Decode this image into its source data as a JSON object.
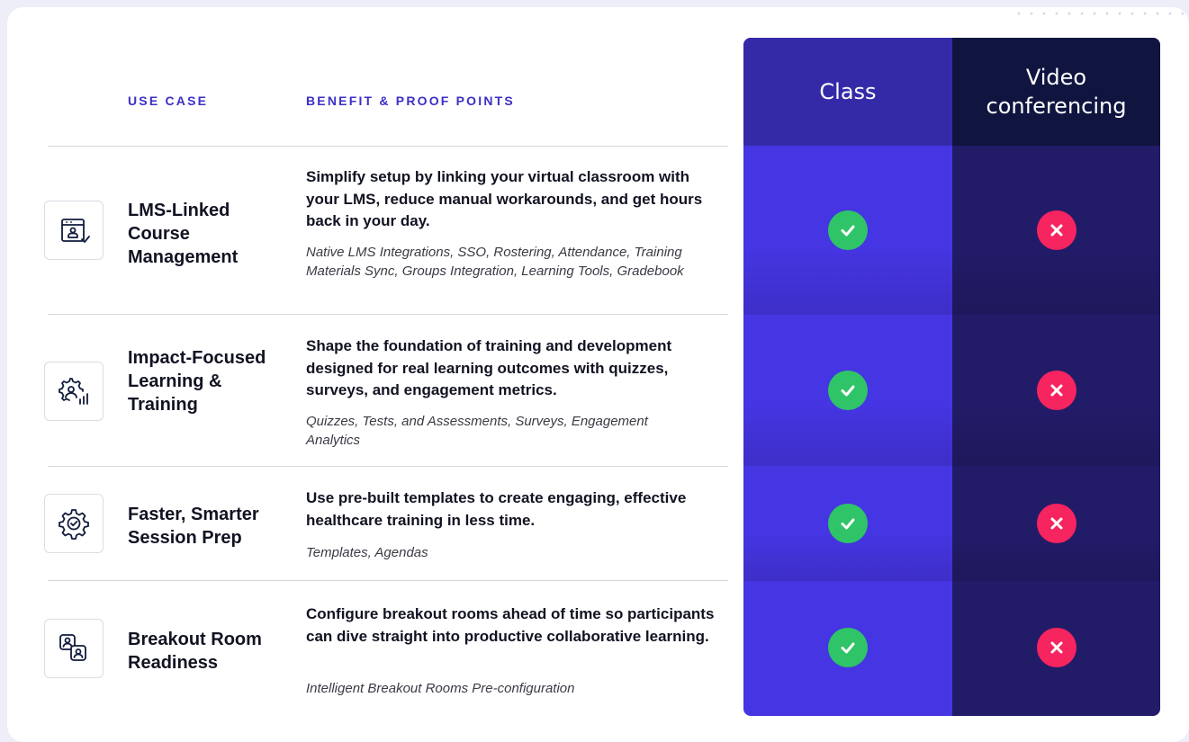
{
  "header": {
    "use_case": "USE CASE",
    "benefit": "BENEFIT & PROOF POINTS",
    "col_class": "Class",
    "col_video": "Video conferencing"
  },
  "rows": [
    {
      "icon": "calendar-user-check-icon",
      "title": "LMS-Linked Course Management",
      "benefit": "Simplify setup by linking your virtual classroom with your LMS, reduce manual workarounds, and get hours back in your day.",
      "proof": "Native LMS Integrations, SSO, Rostering, Attendance, Training Materials Sync, Groups Integration, Learning Tools, Gradebook",
      "class": "check",
      "video": "cross"
    },
    {
      "icon": "gear-user-chart-icon",
      "title": "Impact-Focused Learning & Training",
      "benefit": "Shape the foundation of training and development designed for real learning outcomes with quizzes, surveys, and engagement metrics.",
      "proof": "Quizzes, Tests, and Assessments, Surveys, Engagement Analytics",
      "class": "check",
      "video": "cross"
    },
    {
      "icon": "gear-check-icon",
      "title": "Faster, Smarter Session Prep",
      "benefit": "Use pre-built templates to create engaging, effective healthcare training in less time.",
      "proof": "Templates, Agendas",
      "class": "check",
      "video": "cross"
    },
    {
      "icon": "breakout-users-icon",
      "title": "Breakout Room Readiness",
      "benefit": "Configure breakout rooms ahead of time so participants can dive straight into productive collaborative learning.",
      "proof": "Intelligent Breakout Rooms Pre-configuration",
      "class": "check",
      "video": "cross"
    }
  ],
  "colors": {
    "accent": "#3b2fc6",
    "class_header": "#342aa8",
    "class_column": "#4535e2",
    "video_header": "#101540",
    "video_column": "#221b68",
    "check": "#2fc468",
    "cross": "#f6245f"
  }
}
